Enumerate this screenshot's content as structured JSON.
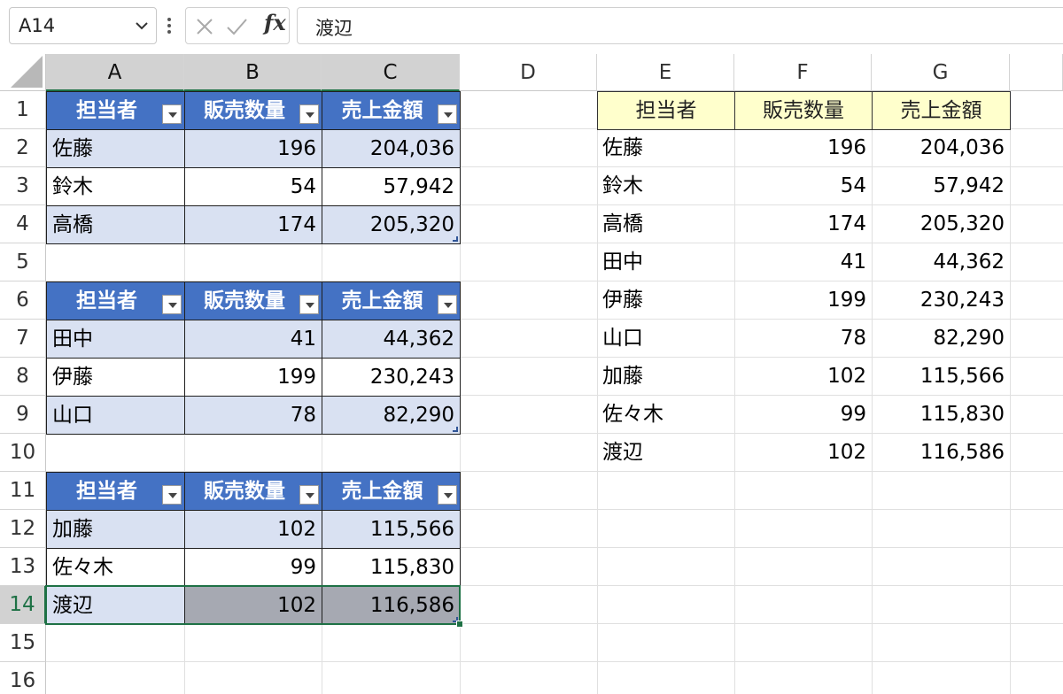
{
  "name_box": {
    "value": "A14"
  },
  "formula_bar": {
    "fx_label": "fx",
    "content": "渡辺"
  },
  "columns": [
    "A",
    "B",
    "C",
    "D",
    "E",
    "F",
    "G"
  ],
  "rows": [
    "1",
    "2",
    "3",
    "4",
    "5",
    "6",
    "7",
    "8",
    "9",
    "10",
    "11",
    "12",
    "13",
    "14",
    "15",
    "16"
  ],
  "tables": [
    {
      "headers": [
        "担当者",
        "販売数量",
        "売上金額"
      ],
      "rows": [
        {
          "name": "佐藤",
          "qty": "196",
          "amount": "204,036"
        },
        {
          "name": "鈴木",
          "qty": "54",
          "amount": "57,942"
        },
        {
          "name": "高橋",
          "qty": "174",
          "amount": "205,320"
        }
      ]
    },
    {
      "headers": [
        "担当者",
        "販売数量",
        "売上金額"
      ],
      "rows": [
        {
          "name": "田中",
          "qty": "41",
          "amount": "44,362"
        },
        {
          "name": "伊藤",
          "qty": "199",
          "amount": "230,243"
        },
        {
          "name": "山口",
          "qty": "78",
          "amount": "82,290"
        }
      ]
    },
    {
      "headers": [
        "担当者",
        "販売数量",
        "売上金額"
      ],
      "rows": [
        {
          "name": "加藤",
          "qty": "102",
          "amount": "115,566"
        },
        {
          "name": "佐々木",
          "qty": "99",
          "amount": "115,830"
        },
        {
          "name": "渡辺",
          "qty": "102",
          "amount": "116,586"
        }
      ]
    }
  ],
  "combined": {
    "headers": [
      "担当者",
      "販売数量",
      "売上金額"
    ],
    "rows": [
      {
        "name": "佐藤",
        "qty": "196",
        "amount": "204,036"
      },
      {
        "name": "鈴木",
        "qty": "54",
        "amount": "57,942"
      },
      {
        "name": "高橋",
        "qty": "174",
        "amount": "205,320"
      },
      {
        "name": "田中",
        "qty": "41",
        "amount": "44,362"
      },
      {
        "name": "伊藤",
        "qty": "199",
        "amount": "230,243"
      },
      {
        "name": "山口",
        "qty": "78",
        "amount": "82,290"
      },
      {
        "name": "加藤",
        "qty": "102",
        "amount": "115,566"
      },
      {
        "name": "佐々木",
        "qty": "99",
        "amount": "115,830"
      },
      {
        "name": "渡辺",
        "qty": "102",
        "amount": "116,586"
      }
    ]
  },
  "selection": {
    "active_cell": "A14",
    "range": "A14:C14"
  },
  "colors": {
    "table_header": "#4472c4",
    "band": "#d9e1f2",
    "selected_grey": "#a6a9b2",
    "highlight_header": "#ffffcc",
    "selection_border": "#1e7145"
  }
}
